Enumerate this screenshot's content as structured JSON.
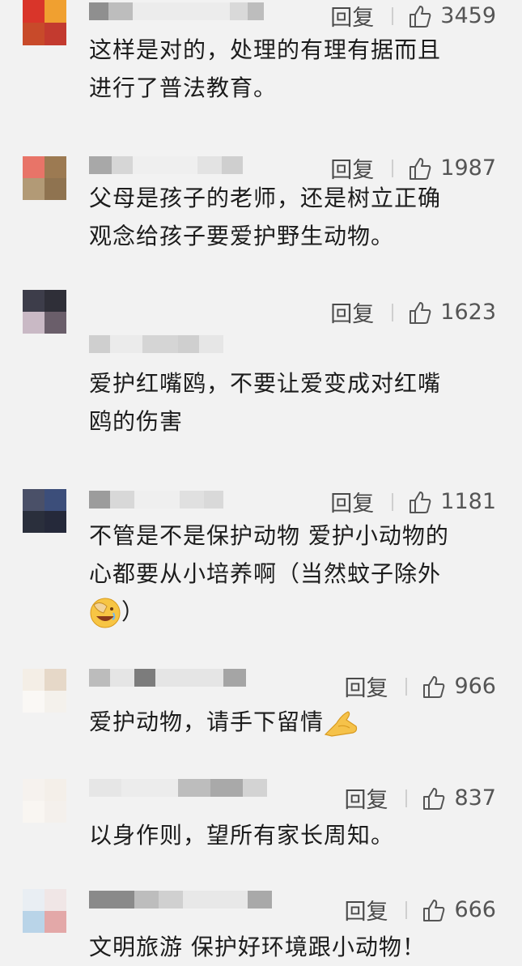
{
  "reply_label": "回复",
  "comments": [
    {
      "text_lines": [
        "这样是对的，处理的有理有据而且",
        "进行了普法教育。"
      ],
      "likes": "3459",
      "avatar": [
        "#d9352a",
        "#f0a030",
        "#c84a2a",
        "#c33a2f"
      ],
      "name_blur": [
        "#8f8f8f",
        "#bdbdbd",
        "#ececec",
        "#d9d9d9",
        "#bdbdbd"
      ]
    },
    {
      "text_lines": [
        "父母是孩子的老师，还是树立正确",
        "观念给孩子要爱护野生动物。"
      ],
      "likes": "1987",
      "avatar": [
        "#e87468",
        "#9c7a52",
        "#b29a76",
        "#8f7350"
      ],
      "name_blur": [
        "#a8a8a8",
        "#d6d6d6",
        "#efefef",
        "#e3e3e3",
        "#cfcfcf"
      ]
    },
    {
      "text_lines": [
        "爱护红嘴鸥，不要让爱变成对红嘴",
        "鸥的伤害"
      ],
      "likes": "1623",
      "avatar": [
        "#3d3d4a",
        "#2f2f38",
        "#c9b9c5",
        "#6a5e6a"
      ],
      "name_blur": [
        "#cfcfcf",
        "#ebebeb",
        "#d5d5d5",
        "#cfcfcf",
        "#e6e6e6"
      ]
    },
    {
      "text_lines": [
        "不管是不是保护动物 爱护小动物的",
        "心都要从小培养啊（当然蚊子除外",
        "）"
      ],
      "likes": "1181",
      "avatar": [
        "#4a5068",
        "#3c4e7a",
        "#2a2f3c",
        "#25293a"
      ],
      "name_blur": [
        "#9c9c9c",
        "#d8d8d8",
        "#efefef",
        "#e0e0e0",
        "#d9d9d9"
      ]
    },
    {
      "text_lines": [
        "爱护动物，请手下留情"
      ],
      "likes": "966",
      "avatar": [
        "#f4eee6",
        "#e6d8c8",
        "#faf8f5",
        "#f4f1ec"
      ],
      "name_blur": [
        "#bcbcbc",
        "#e5e5e5",
        "#7c7c7c",
        "#e5e5e5",
        "#a5a5a5"
      ]
    },
    {
      "text_lines": [
        "以身作则，望所有家长周知。"
      ],
      "likes": "837",
      "avatar": [
        "#f6f2ee",
        "#f4efe9",
        "#f9f6f2",
        "#f4f0ec"
      ],
      "name_blur": [
        "#e6e6e6",
        "#ececec",
        "#bdbdbd",
        "#a9a9a9",
        "#d3d3d3"
      ]
    },
    {
      "text_lines": [
        "文明旅游 保护好环境跟小动物！"
      ],
      "likes": "666",
      "avatar": [
        "#e9eef3",
        "#f0e6e6",
        "#b9d4e8",
        "#e3a8a8"
      ],
      "name_blur": [
        "#8a8a8a",
        "#bdbdbd",
        "#d0d0d0",
        "#e8e8e8",
        "#a9a9a9"
      ]
    }
  ]
}
